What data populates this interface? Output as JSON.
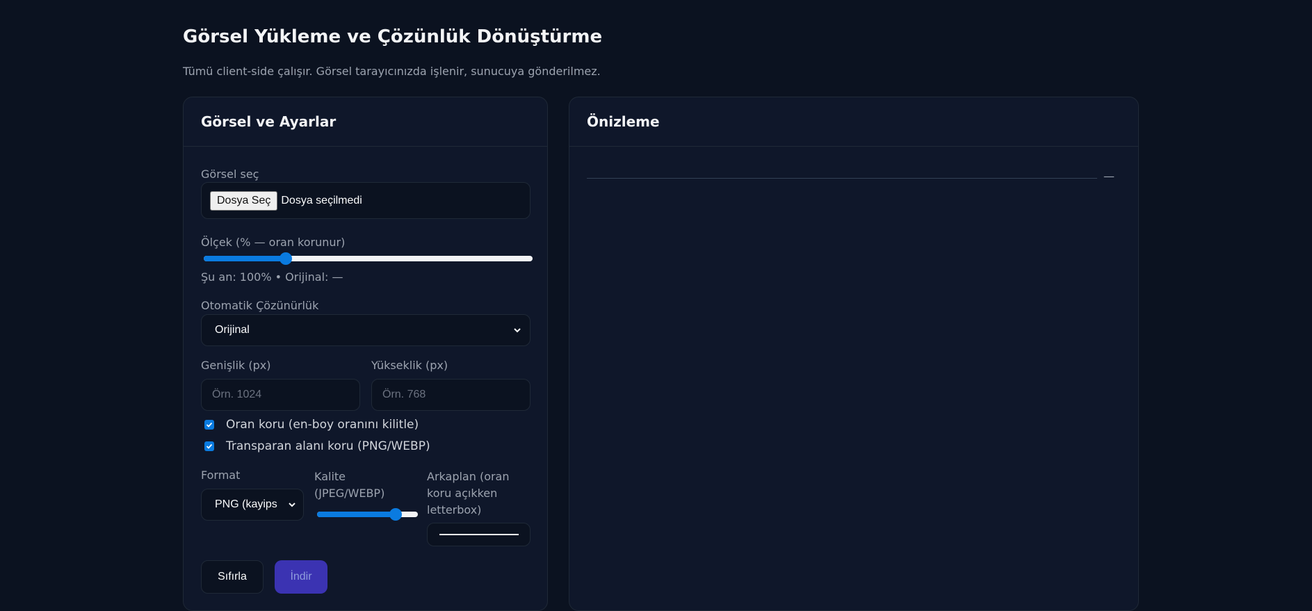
{
  "page": {
    "title": "Görsel Yükleme ve Çözünlük Dönüştürme",
    "subtitle": "Tümü client-side çalışır. Görsel tarayıcınızda işlenir, sunucuya gönderilmez."
  },
  "settings": {
    "header": "Görsel ve Ayarlar",
    "file": {
      "label": "Görsel seç",
      "button": "Dosya Seç",
      "status": "Dosya seçilmedi"
    },
    "scale": {
      "label": "Ölçek (% — oran korunur)",
      "value_fraction": 0.24,
      "status": "Şu an: 100% • Orijinal: —"
    },
    "auto_resolution": {
      "label": "Otomatik Çözünürlük",
      "selected": "Orijinal"
    },
    "width": {
      "label": "Genişlik (px)",
      "placeholder": "Örn. 1024"
    },
    "height": {
      "label": "Yükseklik (px)",
      "placeholder": "Örn. 768"
    },
    "keep_ratio": {
      "label": "Oran koru (en-boy oranını kilitle)",
      "checked": true
    },
    "keep_transparency": {
      "label": "Transparan alanı koru (PNG/WEBP)",
      "checked": true
    },
    "format": {
      "label": "Format",
      "selected": "PNG (kayips"
    },
    "quality": {
      "label_line1": "Kalite",
      "label_line2": "(JPEG/WEBP)",
      "value_fraction": 0.82
    },
    "background": {
      "label_line1": "Arkaplan (oran",
      "label_line2": "koru açıkken",
      "label_line3": "letterbox)",
      "color": "#ffffff"
    },
    "reset_button": "Sıfırla",
    "download_button": "İndir"
  },
  "preview": {
    "header": "Önizleme",
    "info": "—"
  },
  "colors": {
    "accent": "#0a7be0",
    "background": "#0b1220",
    "card": "#0f172a",
    "button_primary": "#4338ca"
  }
}
